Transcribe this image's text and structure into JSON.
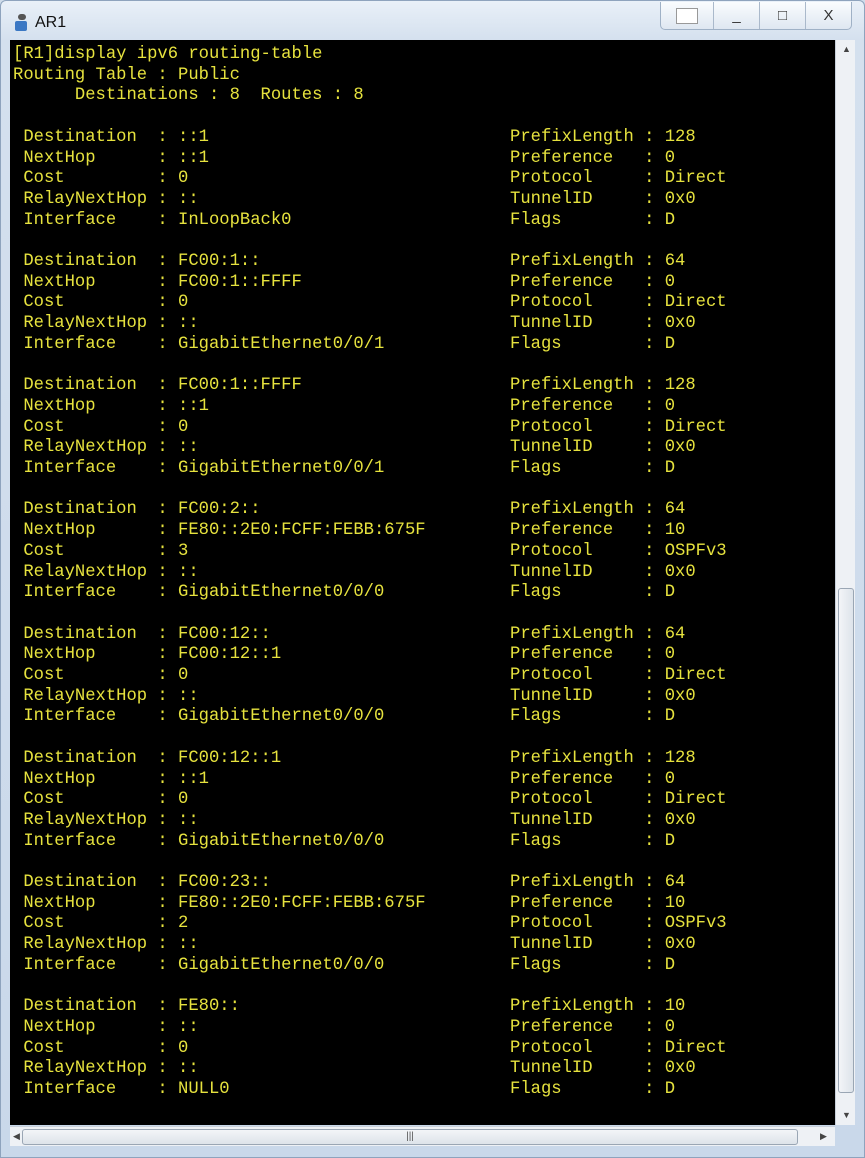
{
  "window": {
    "title": "AR1",
    "buttons": {
      "minimize": "_",
      "maximize": "□",
      "close": "X"
    }
  },
  "terminal": {
    "header": [
      "[R1]display ipv6 routing-table",
      "Routing Table : Public",
      "      Destinations : 8  Routes : 8"
    ],
    "labels": {
      "left": [
        "Destination",
        "NextHop",
        "Cost",
        "RelayNextHop",
        "Interface"
      ],
      "right": [
        "PrefixLength",
        "Preference",
        "Protocol",
        "TunnelID",
        "Flags"
      ]
    },
    "routes": [
      {
        "destination": "::1",
        "nexthop": "::1",
        "cost": "0",
        "relay": "::",
        "interface": "InLoopBack0",
        "prefix": "128",
        "preference": "0",
        "protocol": "Direct",
        "tunnel": "0x0",
        "flags": "D"
      },
      {
        "destination": "FC00:1::",
        "nexthop": "FC00:1::FFFF",
        "cost": "0",
        "relay": "::",
        "interface": "GigabitEthernet0/0/1",
        "prefix": "64",
        "preference": "0",
        "protocol": "Direct",
        "tunnel": "0x0",
        "flags": "D"
      },
      {
        "destination": "FC00:1::FFFF",
        "nexthop": "::1",
        "cost": "0",
        "relay": "::",
        "interface": "GigabitEthernet0/0/1",
        "prefix": "128",
        "preference": "0",
        "protocol": "Direct",
        "tunnel": "0x0",
        "flags": "D"
      },
      {
        "destination": "FC00:2::",
        "nexthop": "FE80::2E0:FCFF:FEBB:675F",
        "cost": "3",
        "relay": "::",
        "interface": "GigabitEthernet0/0/0",
        "prefix": "64",
        "preference": "10",
        "protocol": "OSPFv3",
        "tunnel": "0x0",
        "flags": "D"
      },
      {
        "destination": "FC00:12::",
        "nexthop": "FC00:12::1",
        "cost": "0",
        "relay": "::",
        "interface": "GigabitEthernet0/0/0",
        "prefix": "64",
        "preference": "0",
        "protocol": "Direct",
        "tunnel": "0x0",
        "flags": "D"
      },
      {
        "destination": "FC00:12::1",
        "nexthop": "::1",
        "cost": "0",
        "relay": "::",
        "interface": "GigabitEthernet0/0/0",
        "prefix": "128",
        "preference": "0",
        "protocol": "Direct",
        "tunnel": "0x0",
        "flags": "D"
      },
      {
        "destination": "FC00:23::",
        "nexthop": "FE80::2E0:FCFF:FEBB:675F",
        "cost": "2",
        "relay": "::",
        "interface": "GigabitEthernet0/0/0",
        "prefix": "64",
        "preference": "10",
        "protocol": "OSPFv3",
        "tunnel": "0x0",
        "flags": "D"
      },
      {
        "destination": "FE80::",
        "nexthop": "::",
        "cost": "0",
        "relay": "::",
        "interface": "NULL0",
        "prefix": "10",
        "preference": "0",
        "protocol": "Direct",
        "tunnel": "0x0",
        "flags": "D"
      }
    ]
  },
  "colors": {
    "terminal_bg": "#000000",
    "terminal_text": "#e6e23e"
  }
}
